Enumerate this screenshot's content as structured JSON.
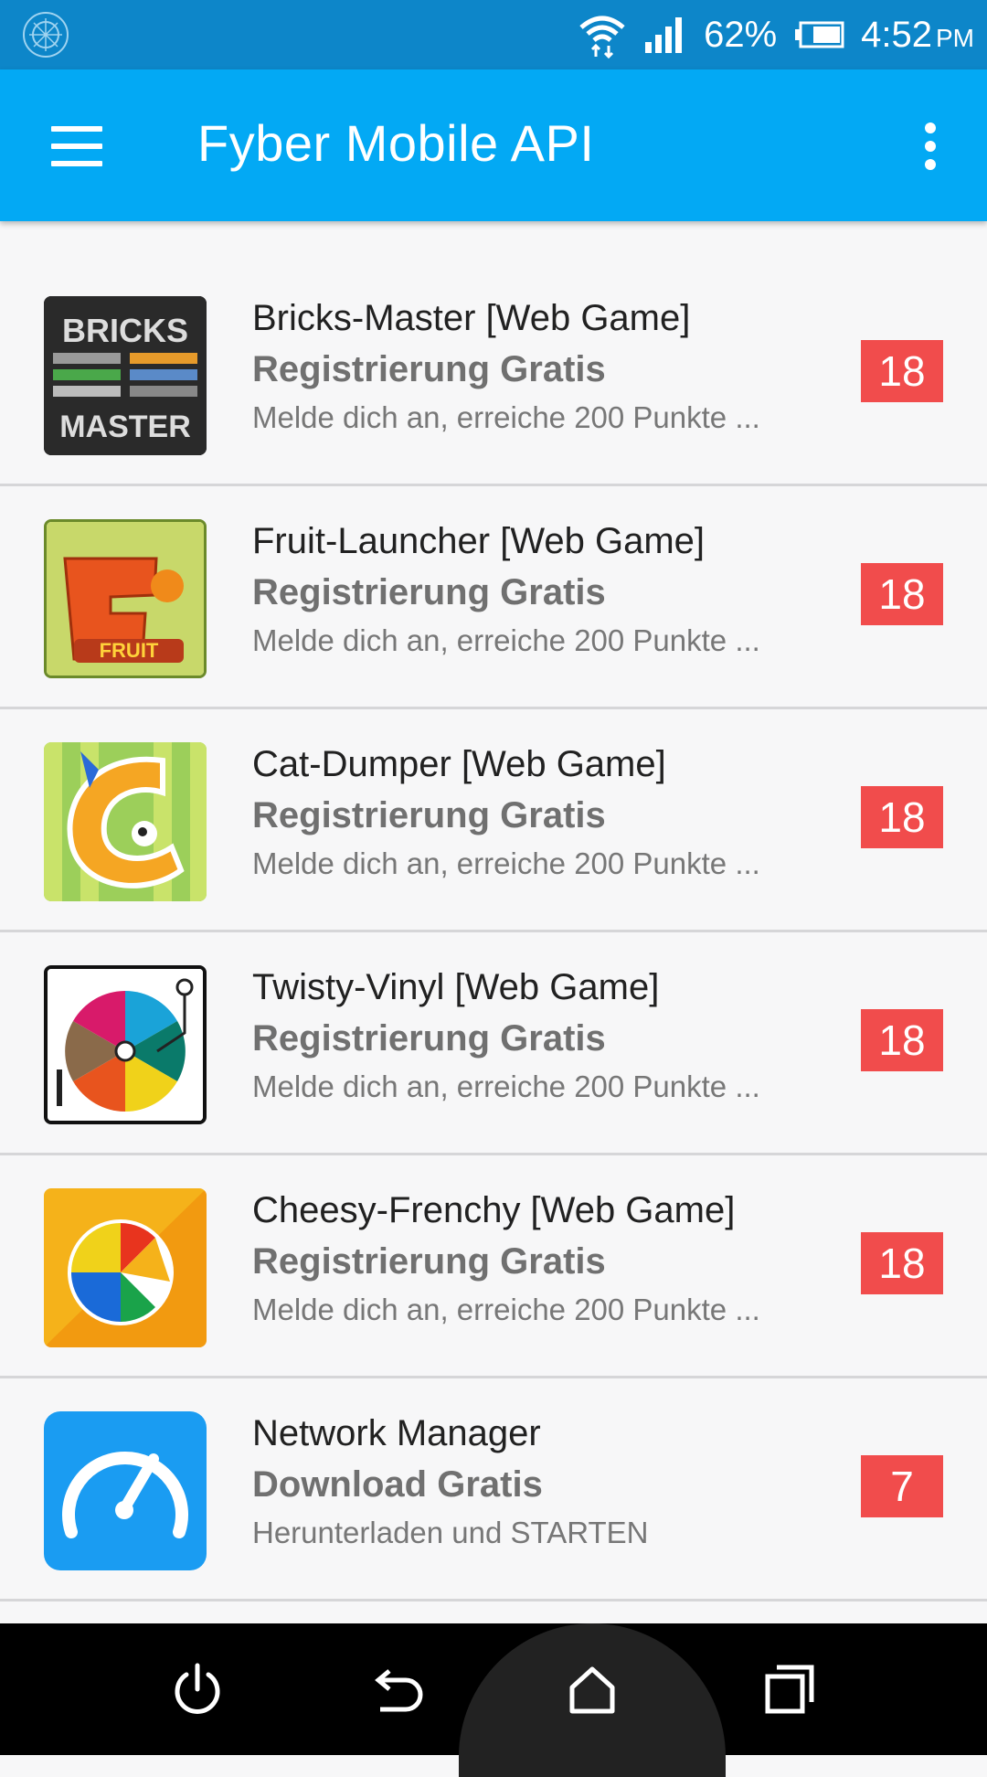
{
  "status_bar": {
    "battery": "62%",
    "time": "4:52",
    "ampm": "PM"
  },
  "app_bar": {
    "title": "Fyber Mobile API"
  },
  "colors": {
    "status_bar": "#0d86c9",
    "app_bar": "#03a9f4",
    "badge": "#f14c4c",
    "background": "#f7f7f8"
  },
  "offers": [
    {
      "title": "Bricks-Master [Web Game]",
      "subtitle": "Registrierung Gratis",
      "description": "Melde dich an, erreiche 200 Punkte ...",
      "points": "18",
      "icon": "bricks-master-icon"
    },
    {
      "title": "Fruit-Launcher [Web Game]",
      "subtitle": "Registrierung Gratis",
      "description": "Melde dich an, erreiche 200 Punkte ...",
      "points": "18",
      "icon": "fruit-launcher-icon"
    },
    {
      "title": "Cat-Dumper [Web Game]",
      "subtitle": "Registrierung Gratis",
      "description": "Melde dich an, erreiche 200 Punkte ...",
      "points": "18",
      "icon": "cat-dumper-icon"
    },
    {
      "title": "Twisty-Vinyl [Web Game]",
      "subtitle": "Registrierung Gratis",
      "description": "Melde dich an, erreiche 200 Punkte ...",
      "points": "18",
      "icon": "twisty-vinyl-icon"
    },
    {
      "title": "Cheesy-Frenchy [Web Game]",
      "subtitle": "Registrierung Gratis",
      "description": "Melde dich an, erreiche 200 Punkte ...",
      "points": "18",
      "icon": "cheesy-frenchy-icon"
    },
    {
      "title": "Network Manager",
      "subtitle": "Download Gratis",
      "description": "Herunterladen und STARTEN",
      "points": "7",
      "icon": "network-manager-icon"
    }
  ]
}
